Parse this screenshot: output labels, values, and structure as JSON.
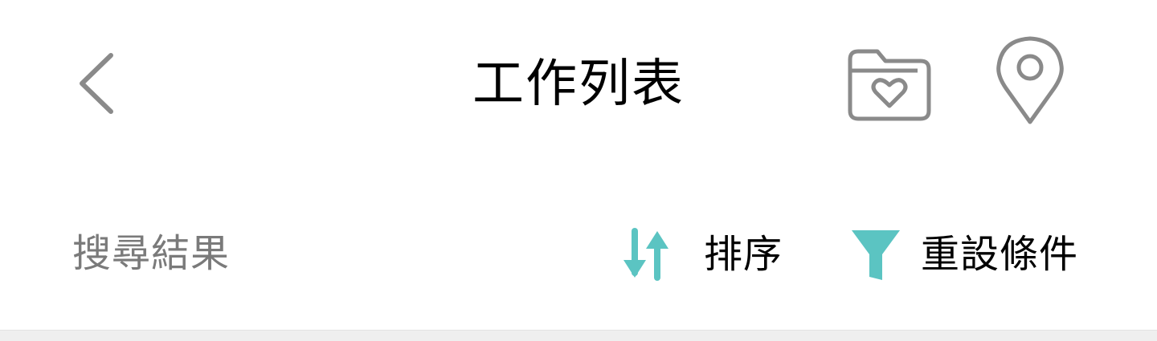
{
  "header": {
    "title": "工作列表",
    "back_icon": "chevron-left-icon",
    "favorites_icon": "heart-folder-icon",
    "location_icon": "location-pin-icon"
  },
  "toolbar": {
    "result_label": "搜尋結果",
    "sort_label": "排序",
    "sort_icon": "sort-arrows-icon",
    "reset_label": "重設條件",
    "reset_icon": "filter-icon"
  },
  "colors": {
    "accent": "#5bc4c2",
    "icon_gray": "#8a8a8a",
    "muted_text": "#7a7a7a",
    "divider": "#efefef"
  }
}
